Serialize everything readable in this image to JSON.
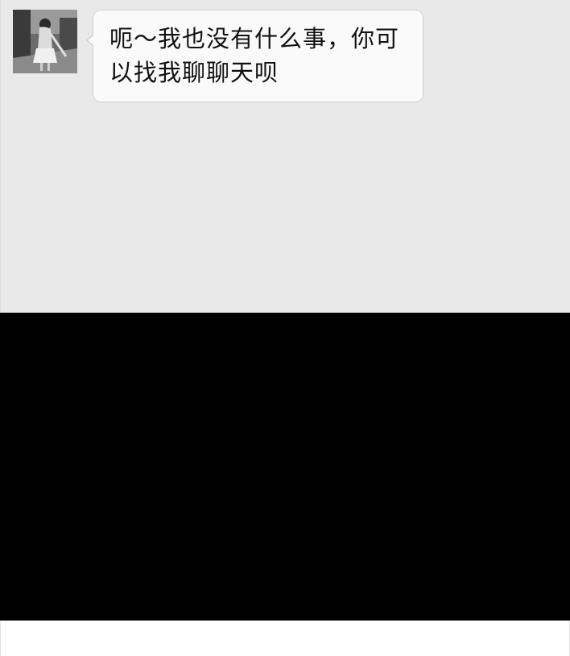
{
  "conversation": {
    "messages": [
      {
        "sender": "contact",
        "avatar": "avatar-photo",
        "text": "呃～我也没有什么事，你可以找我聊聊天呗"
      }
    ]
  },
  "colors": {
    "chat_background": "#e9e9e9",
    "bubble_background": "#fafafa",
    "bubble_border": "#cfcfcf",
    "text": "#111111",
    "lower_panel": "#000000"
  }
}
